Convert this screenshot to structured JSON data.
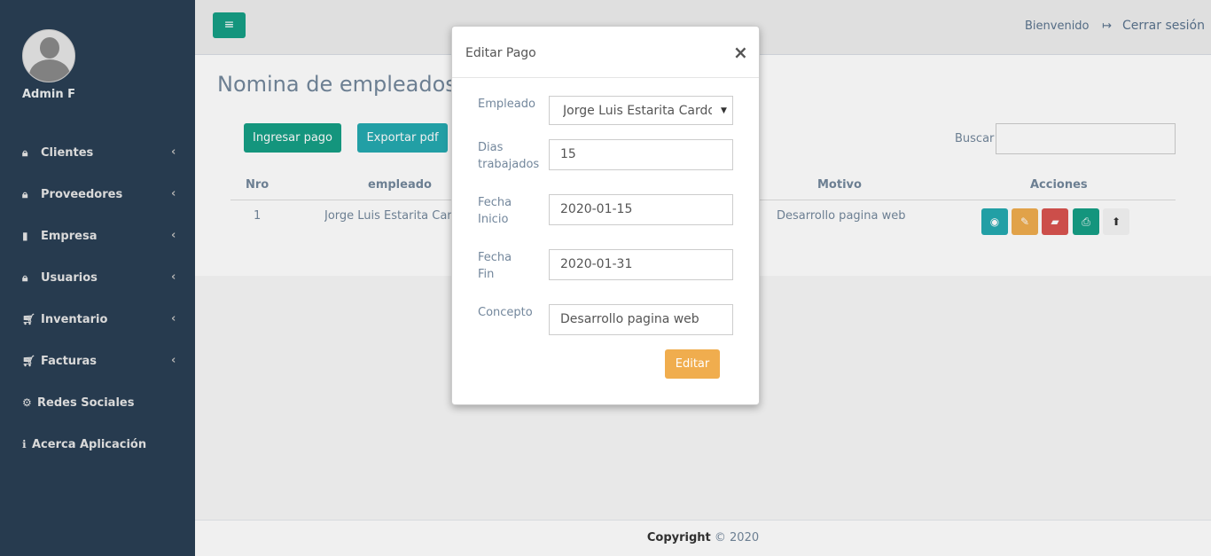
{
  "sidebar": {
    "profile_name": "Admin F",
    "items": [
      {
        "icon": "lock-icon",
        "glyph": "🔒",
        "label": "Clientes",
        "has_chevron": true
      },
      {
        "icon": "lock-icon",
        "glyph": "🔒",
        "label": "Proveedores",
        "has_chevron": true
      },
      {
        "icon": "building-icon",
        "glyph": "▮",
        "label": "Empresa",
        "has_chevron": true
      },
      {
        "icon": "lock-icon",
        "glyph": "🔒",
        "label": "Usuarios",
        "has_chevron": true
      },
      {
        "icon": "cart-icon",
        "glyph": "🛒",
        "label": "Inventario",
        "has_chevron": true
      },
      {
        "icon": "cart-icon",
        "glyph": "🛒",
        "label": "Facturas",
        "has_chevron": true
      },
      {
        "icon": "gear-icon",
        "glyph": "⚙",
        "label": "Redes Sociales",
        "has_chevron": false
      },
      {
        "icon": "info-icon",
        "glyph": "ℹ",
        "label": "Acerca Aplicación",
        "has_chevron": false
      }
    ],
    "chevron": "‹"
  },
  "topbar": {
    "toggle_glyph": "≡",
    "welcome": "Bienvenido",
    "logout_glyph": "↦",
    "logout": "Cerrar sesión"
  },
  "content": {
    "title": "Nomina de empleados",
    "btn_ingresar": "Ingresar pago",
    "btn_exportar": "Exportar pdf",
    "search_label": "Buscar",
    "search_value": "",
    "table": {
      "headers": [
        "Nro",
        "empleado",
        "Motivo",
        "Acciones"
      ],
      "rows": [
        {
          "nro": "1",
          "empleado": "Jorge Luis Estarita Cardo",
          "motivo": "Desarrollo pagina web"
        }
      ],
      "actions": [
        {
          "name": "view",
          "glyph": "👁",
          "color": "#25a9b0"
        },
        {
          "name": "edit",
          "glyph": "✎",
          "color": "#f0ad4e"
        },
        {
          "name": "delete",
          "glyph": "⌫",
          "color": "#d9534f"
        },
        {
          "name": "pdf",
          "glyph": "📄",
          "color": "#169f85"
        },
        {
          "name": "upload",
          "glyph": "⬆",
          "color": "#f5f5f5"
        }
      ]
    }
  },
  "footer": {
    "copyright": "Copyright",
    "year": "© 2020"
  },
  "modal": {
    "title": "Editar Pago",
    "close": "×",
    "fields": {
      "empleado": {
        "label": "Empleado",
        "value": "Jorge Luis Estarita Cardona"
      },
      "dias": {
        "label_line1": "Dias",
        "label_line2": "trabajados",
        "value": "15"
      },
      "fecha_inicio": {
        "label_line1": "Fecha",
        "label_line2": "Inicio",
        "value": "2020-01-15"
      },
      "fecha_fin": {
        "label_line1": "Fecha",
        "label_line2": "Fin",
        "value": "2020-01-31"
      },
      "concepto": {
        "label": "Concepto",
        "value": "Desarrollo pagina web"
      }
    },
    "select_arrow": "▼",
    "submit": "Editar"
  }
}
